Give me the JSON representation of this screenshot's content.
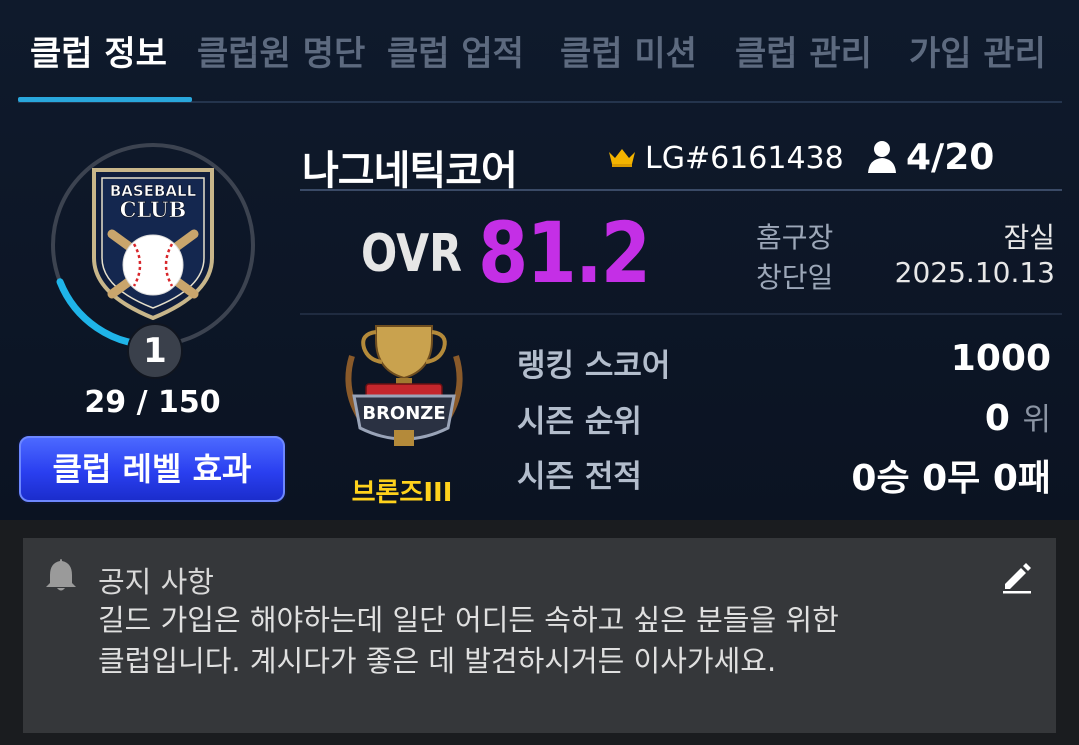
{
  "tabs": [
    {
      "label": "클럽 정보",
      "active": true
    },
    {
      "label": "클럽원 명단",
      "active": false
    },
    {
      "label": "클럽 업적",
      "active": false
    },
    {
      "label": "클럽 미션",
      "active": false
    },
    {
      "label": "클럽 관리",
      "active": false
    },
    {
      "label": "가입 관리",
      "active": false
    }
  ],
  "club": {
    "logo_top": "BASEBALL",
    "logo_bottom": "CLUB",
    "level": "1",
    "exp_text": "29 / 150",
    "level_effect_button": "클럽 레벨 효과",
    "name": "나그네틱코어",
    "club_id": "LG#6161438",
    "members": "4/20",
    "ovr_label": "OVR",
    "ovr_value": "81.2",
    "home_label": "홈구장",
    "home_value": "잠실",
    "founded_label": "창단일",
    "founded_value": "2025.10.13"
  },
  "rank": {
    "emblem_text": "BRONZE",
    "tier_name": "브론즈III",
    "score_label": "랭킹 스코어",
    "score_value": "1000",
    "season_rank_label": "시즌 순위",
    "season_rank_value": "0",
    "season_rank_unit": "위",
    "season_record_label": "시즌 전적",
    "season_record_value": "0승 0무 0패"
  },
  "notice": {
    "title": "공지 사항",
    "text_line1": "길드 가입은 해야하는데 일단 어디든 속하고 싶은 분들을 위한",
    "text_line2": "클럽입니다. 계시다가 좋은 데 발견하시거든 이사가세요."
  },
  "colors": {
    "accent_tab": "#29a7dc",
    "ovr": "#c42fe6",
    "tier": "#ffd21c",
    "button": "#2a3ff0"
  },
  "icons": {
    "crown": "crown-icon",
    "member": "person-icon",
    "bell": "bell-icon",
    "edit": "pencil-icon"
  },
  "exp_progress": 0.19
}
